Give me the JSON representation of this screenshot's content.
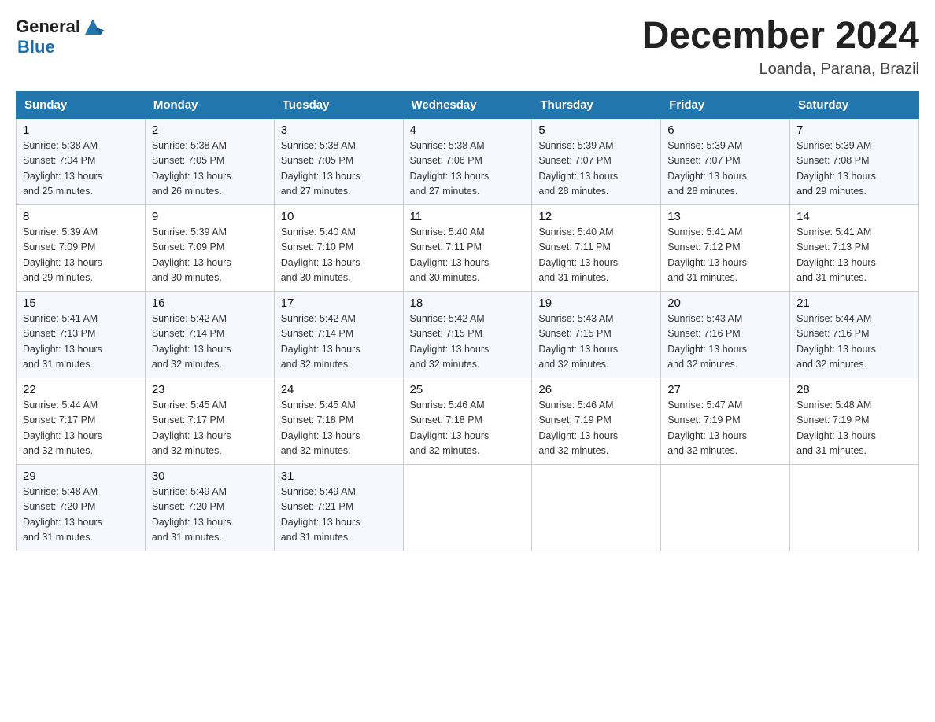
{
  "header": {
    "logo_general": "General",
    "logo_blue": "Blue",
    "title": "December 2024",
    "subtitle": "Loanda, Parana, Brazil"
  },
  "weekdays": [
    "Sunday",
    "Monday",
    "Tuesday",
    "Wednesday",
    "Thursday",
    "Friday",
    "Saturday"
  ],
  "weeks": [
    [
      {
        "day": "1",
        "sunrise": "5:38 AM",
        "sunset": "7:04 PM",
        "daylight": "13 hours and 25 minutes."
      },
      {
        "day": "2",
        "sunrise": "5:38 AM",
        "sunset": "7:05 PM",
        "daylight": "13 hours and 26 minutes."
      },
      {
        "day": "3",
        "sunrise": "5:38 AM",
        "sunset": "7:05 PM",
        "daylight": "13 hours and 27 minutes."
      },
      {
        "day": "4",
        "sunrise": "5:38 AM",
        "sunset": "7:06 PM",
        "daylight": "13 hours and 27 minutes."
      },
      {
        "day": "5",
        "sunrise": "5:39 AM",
        "sunset": "7:07 PM",
        "daylight": "13 hours and 28 minutes."
      },
      {
        "day": "6",
        "sunrise": "5:39 AM",
        "sunset": "7:07 PM",
        "daylight": "13 hours and 28 minutes."
      },
      {
        "day": "7",
        "sunrise": "5:39 AM",
        "sunset": "7:08 PM",
        "daylight": "13 hours and 29 minutes."
      }
    ],
    [
      {
        "day": "8",
        "sunrise": "5:39 AM",
        "sunset": "7:09 PM",
        "daylight": "13 hours and 29 minutes."
      },
      {
        "day": "9",
        "sunrise": "5:39 AM",
        "sunset": "7:09 PM",
        "daylight": "13 hours and 30 minutes."
      },
      {
        "day": "10",
        "sunrise": "5:40 AM",
        "sunset": "7:10 PM",
        "daylight": "13 hours and 30 minutes."
      },
      {
        "day": "11",
        "sunrise": "5:40 AM",
        "sunset": "7:11 PM",
        "daylight": "13 hours and 30 minutes."
      },
      {
        "day": "12",
        "sunrise": "5:40 AM",
        "sunset": "7:11 PM",
        "daylight": "13 hours and 31 minutes."
      },
      {
        "day": "13",
        "sunrise": "5:41 AM",
        "sunset": "7:12 PM",
        "daylight": "13 hours and 31 minutes."
      },
      {
        "day": "14",
        "sunrise": "5:41 AM",
        "sunset": "7:13 PM",
        "daylight": "13 hours and 31 minutes."
      }
    ],
    [
      {
        "day": "15",
        "sunrise": "5:41 AM",
        "sunset": "7:13 PM",
        "daylight": "13 hours and 31 minutes."
      },
      {
        "day": "16",
        "sunrise": "5:42 AM",
        "sunset": "7:14 PM",
        "daylight": "13 hours and 32 minutes."
      },
      {
        "day": "17",
        "sunrise": "5:42 AM",
        "sunset": "7:14 PM",
        "daylight": "13 hours and 32 minutes."
      },
      {
        "day": "18",
        "sunrise": "5:42 AM",
        "sunset": "7:15 PM",
        "daylight": "13 hours and 32 minutes."
      },
      {
        "day": "19",
        "sunrise": "5:43 AM",
        "sunset": "7:15 PM",
        "daylight": "13 hours and 32 minutes."
      },
      {
        "day": "20",
        "sunrise": "5:43 AM",
        "sunset": "7:16 PM",
        "daylight": "13 hours and 32 minutes."
      },
      {
        "day": "21",
        "sunrise": "5:44 AM",
        "sunset": "7:16 PM",
        "daylight": "13 hours and 32 minutes."
      }
    ],
    [
      {
        "day": "22",
        "sunrise": "5:44 AM",
        "sunset": "7:17 PM",
        "daylight": "13 hours and 32 minutes."
      },
      {
        "day": "23",
        "sunrise": "5:45 AM",
        "sunset": "7:17 PM",
        "daylight": "13 hours and 32 minutes."
      },
      {
        "day": "24",
        "sunrise": "5:45 AM",
        "sunset": "7:18 PM",
        "daylight": "13 hours and 32 minutes."
      },
      {
        "day": "25",
        "sunrise": "5:46 AM",
        "sunset": "7:18 PM",
        "daylight": "13 hours and 32 minutes."
      },
      {
        "day": "26",
        "sunrise": "5:46 AM",
        "sunset": "7:19 PM",
        "daylight": "13 hours and 32 minutes."
      },
      {
        "day": "27",
        "sunrise": "5:47 AM",
        "sunset": "7:19 PM",
        "daylight": "13 hours and 32 minutes."
      },
      {
        "day": "28",
        "sunrise": "5:48 AM",
        "sunset": "7:19 PM",
        "daylight": "13 hours and 31 minutes."
      }
    ],
    [
      {
        "day": "29",
        "sunrise": "5:48 AM",
        "sunset": "7:20 PM",
        "daylight": "13 hours and 31 minutes."
      },
      {
        "day": "30",
        "sunrise": "5:49 AM",
        "sunset": "7:20 PM",
        "daylight": "13 hours and 31 minutes."
      },
      {
        "day": "31",
        "sunrise": "5:49 AM",
        "sunset": "7:21 PM",
        "daylight": "13 hours and 31 minutes."
      },
      null,
      null,
      null,
      null
    ]
  ],
  "labels": {
    "sunrise": "Sunrise:",
    "sunset": "Sunset:",
    "daylight": "Daylight:"
  }
}
